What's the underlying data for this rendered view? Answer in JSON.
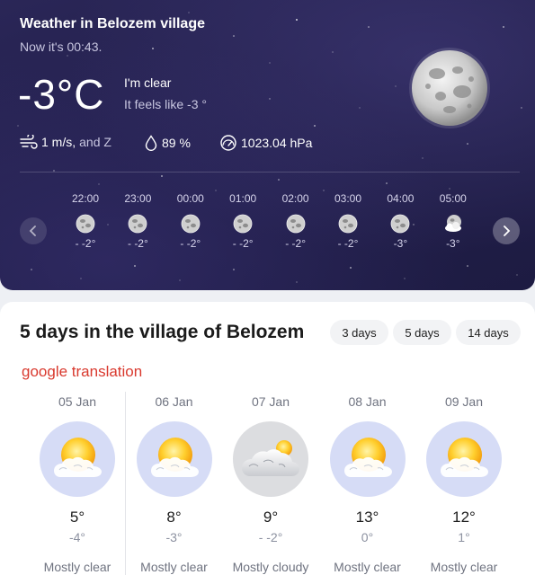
{
  "current": {
    "title": "Weather in Belozem village",
    "now": "Now it's 00:43.",
    "temperature": "-3°C",
    "condition": "I'm clear",
    "feels_like": "It feels like -3 °",
    "wind": "1 m/s,",
    "wind_dir": "and Z",
    "humidity": "89 %",
    "pressure": "1023.04 hPa",
    "icons": [
      "wind-icon",
      "humidity-icon",
      "pressure-icon",
      "moon-icon"
    ]
  },
  "hourly": [
    {
      "time": "22:00",
      "temp": "- -2°",
      "icon": "moon-icon"
    },
    {
      "time": "23:00",
      "temp": "- -2°",
      "icon": "moon-icon"
    },
    {
      "time": "00:00",
      "temp": "- -2°",
      "icon": "moon-icon"
    },
    {
      "time": "01:00",
      "temp": "- -2°",
      "icon": "moon-icon"
    },
    {
      "time": "02:00",
      "temp": "- -2°",
      "icon": "moon-icon"
    },
    {
      "time": "03:00",
      "temp": "- -2°",
      "icon": "moon-icon"
    },
    {
      "time": "04:00",
      "temp": "-3°",
      "icon": "moon-icon"
    },
    {
      "time": "05:00",
      "temp": "-3°",
      "icon": "moon-cloud-icon"
    }
  ],
  "forecast": {
    "title": "5 days in the village of Belozem",
    "ranges": [
      "3 days",
      "5 days",
      "14 days"
    ],
    "translation_label": "google translation",
    "days": [
      {
        "date": "05 Jan",
        "max": "5°",
        "min": "-4°",
        "desc": "Mostly clear",
        "icon": "sun-cloud-icon"
      },
      {
        "date": "06 Jan",
        "max": "8°",
        "min": "-3°",
        "desc": "Mostly clear",
        "icon": "sun-cloud-icon"
      },
      {
        "date": "07 Jan",
        "max": "9°",
        "min": "- -2°",
        "desc": "Mostly cloudy",
        "icon": "cloud-sun-icon"
      },
      {
        "date": "08 Jan",
        "max": "13°",
        "min": "0°",
        "desc": "Mostly clear",
        "icon": "sun-cloud-icon"
      },
      {
        "date": "09 Jan",
        "max": "12°",
        "min": "1°",
        "desc": "Mostly clear",
        "icon": "sun-cloud-icon"
      }
    ]
  },
  "colors": {
    "hero_bg": "#221f4a",
    "accent_red": "#d9392e",
    "icon_circle_clear": "#d6dcf6",
    "icon_circle_cloudy": "#dcdde0"
  }
}
